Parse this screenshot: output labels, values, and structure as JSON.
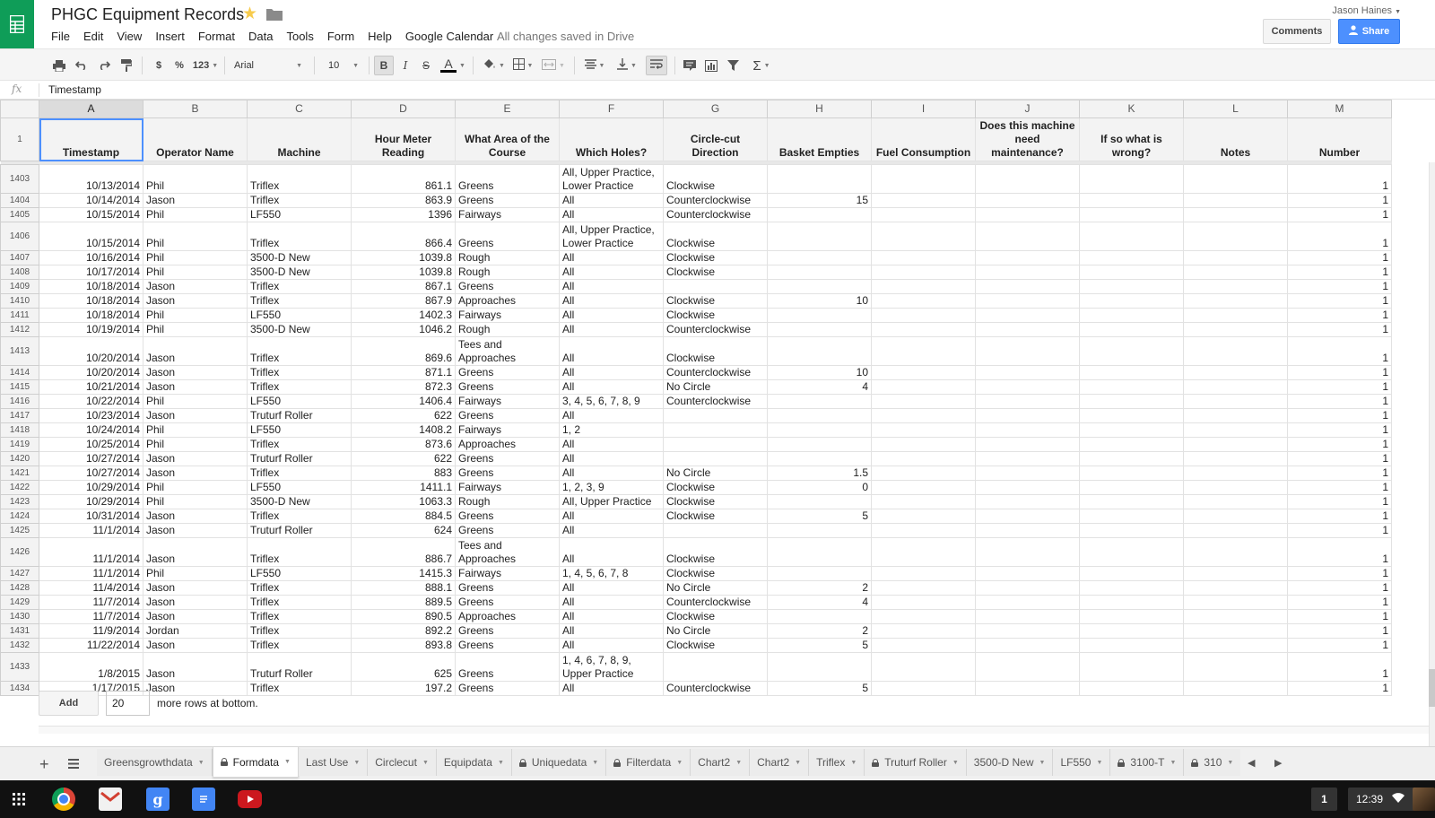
{
  "document": {
    "title": "PHGC Equipment Records",
    "save_status": "All changes saved in Drive",
    "user": "Jason Haines",
    "comments_label": "Comments",
    "share_label": "Share"
  },
  "menu": [
    "File",
    "Edit",
    "View",
    "Insert",
    "Format",
    "Data",
    "Tools",
    "Form",
    "Help",
    "Google Calendar"
  ],
  "toolbar": {
    "currency_label": "$",
    "percent_label": "%",
    "number_format_label": "123",
    "font_family": "Arial",
    "font_size": "10",
    "bold_label": "B",
    "italic_label": "I",
    "strike_label": "S",
    "text_color_label": "A",
    "sum_label": "Σ"
  },
  "icons": {
    "app": "sheets-logo-icon",
    "star": "star-icon",
    "folder": "folder-icon",
    "print": "print-icon",
    "undo": "undo-icon",
    "redo": "redo-icon",
    "paint_format": "paint-format-icon",
    "fill_color": "fill-color-icon",
    "borders": "borders-icon",
    "merge": "merge-cells-icon",
    "align": "horizontal-align-icon",
    "valign": "vertical-align-icon",
    "wrap": "text-wrap-icon",
    "comment": "insert-comment-icon",
    "chart": "insert-chart-icon",
    "filter": "filter-icon",
    "functions": "functions-icon"
  },
  "colors": {
    "brand": "#0f9d58",
    "share": "#4d90fe",
    "selection": "#4d90fe",
    "header_fill": "#f3f3f3"
  },
  "formula_bar": {
    "fx_label": "fx",
    "value": "Timestamp"
  },
  "columns": [
    "A",
    "B",
    "C",
    "D",
    "E",
    "F",
    "G",
    "H",
    "I",
    "J",
    "K",
    "L",
    "M"
  ],
  "header_row": {
    "row_number": "1",
    "cells": [
      "Timestamp",
      "Operator Name",
      "Machine",
      "Hour Meter Reading",
      "What Area of the Course",
      "Which Holes?",
      "Circle-cut Direction",
      "Basket Empties",
      "Fuel Consumption",
      "Does this machine need maintenance?",
      "If so what is wrong?",
      "Notes",
      "Number"
    ]
  },
  "rows": [
    {
      "n": "1403",
      "ts": "10/13/2014",
      "op": "Phil",
      "machine": "Triflex",
      "hours": "861.1",
      "area": "Greens",
      "holes": "All, Upper Practice, Lower Practice",
      "dir": "Clockwise",
      "baskets": "",
      "num": "1"
    },
    {
      "n": "1404",
      "ts": "10/14/2014",
      "op": "Jason",
      "machine": "Triflex",
      "hours": "863.9",
      "area": "Greens",
      "holes": "All",
      "dir": "Counterclockwise",
      "baskets": "15",
      "num": "1"
    },
    {
      "n": "1405",
      "ts": "10/15/2014",
      "op": "Phil",
      "machine": "LF550",
      "hours": "1396",
      "area": "Fairways",
      "holes": "All",
      "dir": "Counterclockwise",
      "baskets": "",
      "num": "1"
    },
    {
      "n": "1406",
      "ts": "10/15/2014",
      "op": "Phil",
      "machine": "Triflex",
      "hours": "866.4",
      "area": "Greens",
      "holes": "All, Upper Practice, Lower Practice",
      "dir": "Clockwise",
      "baskets": "",
      "num": "1"
    },
    {
      "n": "1407",
      "ts": "10/16/2014",
      "op": "Phil",
      "machine": "3500-D New",
      "hours": "1039.8",
      "area": "Rough",
      "holes": "All",
      "dir": "Clockwise",
      "baskets": "",
      "num": "1"
    },
    {
      "n": "1408",
      "ts": "10/17/2014",
      "op": "Phil",
      "machine": "3500-D New",
      "hours": "1039.8",
      "area": "Rough",
      "holes": "All",
      "dir": "Clockwise",
      "baskets": "",
      "num": "1"
    },
    {
      "n": "1409",
      "ts": "10/18/2014",
      "op": "Jason",
      "machine": "Triflex",
      "hours": "867.1",
      "area": "Greens",
      "holes": "All",
      "dir": "",
      "baskets": "",
      "num": "1"
    },
    {
      "n": "1410",
      "ts": "10/18/2014",
      "op": "Jason",
      "machine": "Triflex",
      "hours": "867.9",
      "area": "Approaches",
      "holes": "All",
      "dir": "Clockwise",
      "baskets": "10",
      "num": "1"
    },
    {
      "n": "1411",
      "ts": "10/18/2014",
      "op": "Phil",
      "machine": "LF550",
      "hours": "1402.3",
      "area": "Fairways",
      "holes": "All",
      "dir": "Clockwise",
      "baskets": "",
      "num": "1"
    },
    {
      "n": "1412",
      "ts": "10/19/2014",
      "op": "Phil",
      "machine": "3500-D New",
      "hours": "1046.2",
      "area": "Rough",
      "holes": "All",
      "dir": "Counterclockwise",
      "baskets": "",
      "num": "1"
    },
    {
      "n": "1413",
      "ts": "10/20/2014",
      "op": "Jason",
      "machine": "Triflex",
      "hours": "869.6",
      "area": "Tees and Approaches",
      "holes": "All",
      "dir": "Clockwise",
      "baskets": "",
      "num": "1"
    },
    {
      "n": "1414",
      "ts": "10/20/2014",
      "op": "Jason",
      "machine": "Triflex",
      "hours": "871.1",
      "area": "Greens",
      "holes": "All",
      "dir": "Counterclockwise",
      "baskets": "10",
      "num": "1"
    },
    {
      "n": "1415",
      "ts": "10/21/2014",
      "op": "Jason",
      "machine": "Triflex",
      "hours": "872.3",
      "area": "Greens",
      "holes": "All",
      "dir": "No Circle",
      "baskets": "4",
      "num": "1"
    },
    {
      "n": "1416",
      "ts": "10/22/2014",
      "op": "Phil",
      "machine": "LF550",
      "hours": "1406.4",
      "area": "Fairways",
      "holes": "3, 4, 5, 6, 7, 8, 9",
      "dir": "Counterclockwise",
      "baskets": "",
      "num": "1"
    },
    {
      "n": "1417",
      "ts": "10/23/2014",
      "op": "Jason",
      "machine": "Truturf Roller",
      "hours": "622",
      "area": "Greens",
      "holes": "All",
      "dir": "",
      "baskets": "",
      "num": "1"
    },
    {
      "n": "1418",
      "ts": "10/24/2014",
      "op": "Phil",
      "machine": "LF550",
      "hours": "1408.2",
      "area": "Fairways",
      "holes": "1, 2",
      "dir": "",
      "baskets": "",
      "num": "1"
    },
    {
      "n": "1419",
      "ts": "10/25/2014",
      "op": "Phil",
      "machine": "Triflex",
      "hours": "873.6",
      "area": "Approaches",
      "holes": "All",
      "dir": "",
      "baskets": "",
      "num": "1"
    },
    {
      "n": "1420",
      "ts": "10/27/2014",
      "op": "Jason",
      "machine": "Truturf Roller",
      "hours": "622",
      "area": "Greens",
      "holes": "All",
      "dir": "",
      "baskets": "",
      "num": "1"
    },
    {
      "n": "1421",
      "ts": "10/27/2014",
      "op": "Jason",
      "machine": "Triflex",
      "hours": "883",
      "area": "Greens",
      "holes": "All",
      "dir": "No Circle",
      "baskets": "1.5",
      "num": "1"
    },
    {
      "n": "1422",
      "ts": "10/29/2014",
      "op": "Phil",
      "machine": "LF550",
      "hours": "1411.1",
      "area": "Fairways",
      "holes": "1, 2, 3, 9",
      "dir": "Clockwise",
      "baskets": "0",
      "num": "1"
    },
    {
      "n": "1423",
      "ts": "10/29/2014",
      "op": "Phil",
      "machine": "3500-D New",
      "hours": "1063.3",
      "area": "Rough",
      "holes": "All, Upper Practice",
      "dir": "Clockwise",
      "baskets": "",
      "num": "1"
    },
    {
      "n": "1424",
      "ts": "10/31/2014",
      "op": "Jason",
      "machine": "Triflex",
      "hours": "884.5",
      "area": "Greens",
      "holes": "All",
      "dir": "Clockwise",
      "baskets": "5",
      "num": "1"
    },
    {
      "n": "1425",
      "ts": "11/1/2014",
      "op": "Jason",
      "machine": "Truturf Roller",
      "hours": "624",
      "area": "Greens",
      "holes": "All",
      "dir": "",
      "baskets": "",
      "num": "1"
    },
    {
      "n": "1426",
      "ts": "11/1/2014",
      "op": "Jason",
      "machine": "Triflex",
      "hours": "886.7",
      "area": "Tees and Approaches",
      "holes": "All",
      "dir": "Clockwise",
      "baskets": "",
      "num": "1"
    },
    {
      "n": "1427",
      "ts": "11/1/2014",
      "op": "Phil",
      "machine": "LF550",
      "hours": "1415.3",
      "area": "Fairways",
      "holes": "1, 4, 5, 6, 7, 8",
      "dir": "Clockwise",
      "baskets": "",
      "num": "1"
    },
    {
      "n": "1428",
      "ts": "11/4/2014",
      "op": "Jason",
      "machine": "Triflex",
      "hours": "888.1",
      "area": "Greens",
      "holes": "All",
      "dir": "No Circle",
      "baskets": "2",
      "num": "1"
    },
    {
      "n": "1429",
      "ts": "11/7/2014",
      "op": "Jason",
      "machine": "Triflex",
      "hours": "889.5",
      "area": "Greens",
      "holes": "All",
      "dir": "Counterclockwise",
      "baskets": "4",
      "num": "1"
    },
    {
      "n": "1430",
      "ts": "11/7/2014",
      "op": "Jason",
      "machine": "Triflex",
      "hours": "890.5",
      "area": "Approaches",
      "holes": "All",
      "dir": "Clockwise",
      "baskets": "",
      "num": "1"
    },
    {
      "n": "1431",
      "ts": "11/9/2014",
      "op": "Jordan",
      "machine": "Triflex",
      "hours": "892.2",
      "area": "Greens",
      "holes": "All",
      "dir": "No Circle",
      "baskets": "2",
      "num": "1"
    },
    {
      "n": "1432",
      "ts": "11/22/2014",
      "op": "Jason",
      "machine": "Triflex",
      "hours": "893.8",
      "area": "Greens",
      "holes": "All",
      "dir": "Clockwise",
      "baskets": "5",
      "num": "1"
    },
    {
      "n": "1433",
      "ts": "1/8/2015",
      "op": "Jason",
      "machine": "Truturf Roller",
      "hours": "625",
      "area": "Greens",
      "holes": "1, 4, 6, 7, 8, 9, Upper Practice",
      "dir": "",
      "baskets": "",
      "num": "1"
    },
    {
      "n": "1434",
      "ts": "1/17/2015",
      "op": "Jason",
      "machine": "Triflex",
      "hours": "197.2",
      "area": "Greens",
      "holes": "All",
      "dir": "Counterclockwise",
      "baskets": "5",
      "num": "1"
    }
  ],
  "add_rows": {
    "button_label": "Add",
    "count": "20",
    "suffix": "more rows at bottom."
  },
  "sheet_tabs": [
    {
      "label": "Greensgrowthdata",
      "locked": false,
      "active": false
    },
    {
      "label": "Formdata",
      "locked": true,
      "active": true
    },
    {
      "label": "Last Use",
      "locked": false,
      "active": false
    },
    {
      "label": "Circlecut",
      "locked": false,
      "active": false
    },
    {
      "label": "Equipdata",
      "locked": false,
      "active": false
    },
    {
      "label": "Uniquedata",
      "locked": true,
      "active": false
    },
    {
      "label": "Filterdata",
      "locked": true,
      "active": false
    },
    {
      "label": "Chart2",
      "locked": false,
      "active": false
    },
    {
      "label": "Chart2",
      "locked": false,
      "active": false
    },
    {
      "label": "Triflex",
      "locked": false,
      "active": false
    },
    {
      "label": "Truturf Roller",
      "locked": true,
      "active": false
    },
    {
      "label": "3500-D New",
      "locked": false,
      "active": false
    },
    {
      "label": "LF550",
      "locked": false,
      "active": false
    },
    {
      "label": "3100-T",
      "locked": true,
      "active": false
    },
    {
      "label": "310",
      "locked": true,
      "active": false
    }
  ],
  "taskbar": {
    "notification_count": "1",
    "clock": "12:39",
    "apps": [
      "launcher-icon",
      "chrome-icon",
      "gmail-icon",
      "google-search-icon",
      "docs-icon",
      "youtube-icon"
    ]
  }
}
